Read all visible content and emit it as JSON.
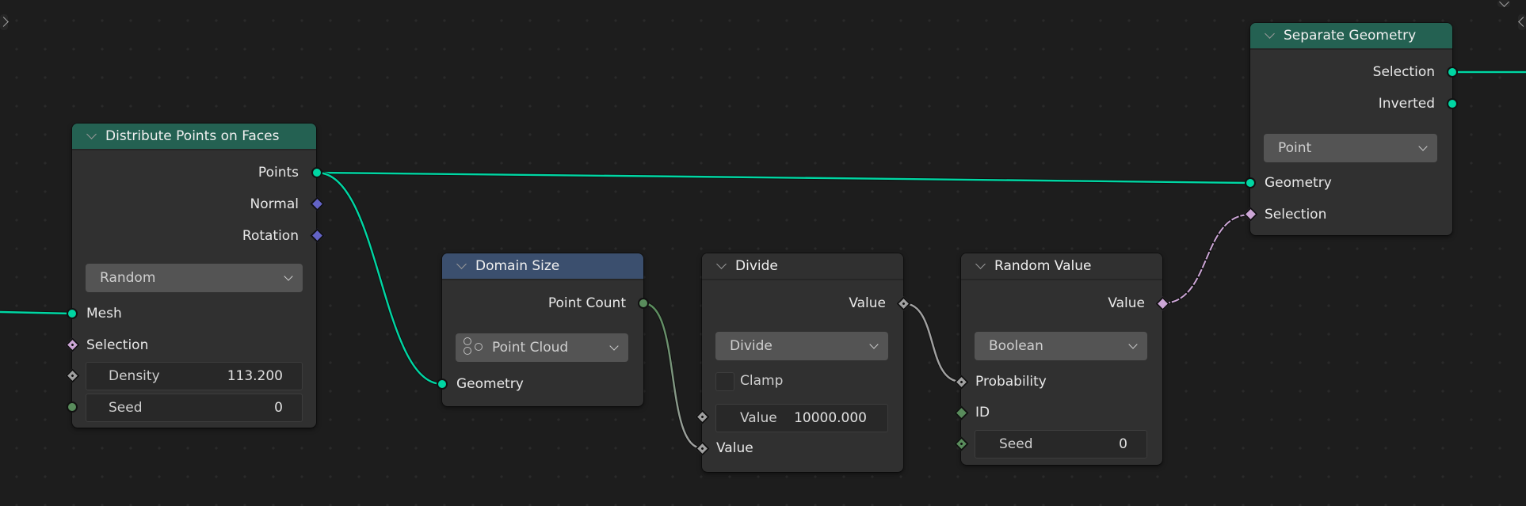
{
  "editor": "Geometry Node Editor",
  "colors": {
    "geometry_socket": "#00d6a3",
    "vector_socket": "#6363c7",
    "boolean_socket": "#cca6d6",
    "float_socket": "#a1a1a1",
    "integer_socket": "#598c5c",
    "geometry_header": "#246152",
    "attribute_header": "#3b4f6e",
    "utility_header": "#303030"
  },
  "nodes": {
    "distribute": {
      "title": "Distribute Points on Faces",
      "outputs": [
        "Points",
        "Normal",
        "Rotation"
      ],
      "mode": "Random",
      "inputs": {
        "mesh": "Mesh",
        "selection": "Selection",
        "density_label": "Density",
        "density_value": "113.200",
        "seed_label": "Seed",
        "seed_value": "0"
      }
    },
    "domain_size": {
      "title": "Domain Size",
      "output": "Point Count",
      "component": "Point Cloud",
      "input": "Geometry"
    },
    "divide": {
      "title": "Divide",
      "output": "Value",
      "operation": "Divide",
      "clamp_label": "Clamp",
      "clamp_checked": false,
      "value1_label": "Value",
      "value1_value": "10000.000",
      "value2_label": "Value"
    },
    "random_value": {
      "title": "Random Value",
      "output": "Value",
      "data_type": "Boolean",
      "probability": "Probability",
      "id": "ID",
      "seed_label": "Seed",
      "seed_value": "0"
    },
    "separate_geometry": {
      "title": "Separate Geometry",
      "outputs": [
        "Selection",
        "Inverted"
      ],
      "domain": "Point",
      "inputs": [
        "Geometry",
        "Selection"
      ]
    }
  },
  "links": [
    {
      "from": "distribute.Points",
      "to": "separate_geometry.Geometry",
      "type": "geometry"
    },
    {
      "from": "distribute.Points",
      "to": "domain_size.Geometry",
      "type": "geometry"
    },
    {
      "from": "domain_size.Point Count",
      "to": "divide.Value(2)",
      "type": "integer-to-float"
    },
    {
      "from": "divide.Value",
      "to": "random_value.Probability",
      "type": "float"
    },
    {
      "from": "random_value.Value",
      "to": "separate_geometry.Selection",
      "type": "boolean"
    },
    {
      "from": "external",
      "to": "distribute.Mesh",
      "type": "geometry"
    },
    {
      "from": "separate_geometry.Selection",
      "to": "external",
      "type": "geometry"
    }
  ]
}
